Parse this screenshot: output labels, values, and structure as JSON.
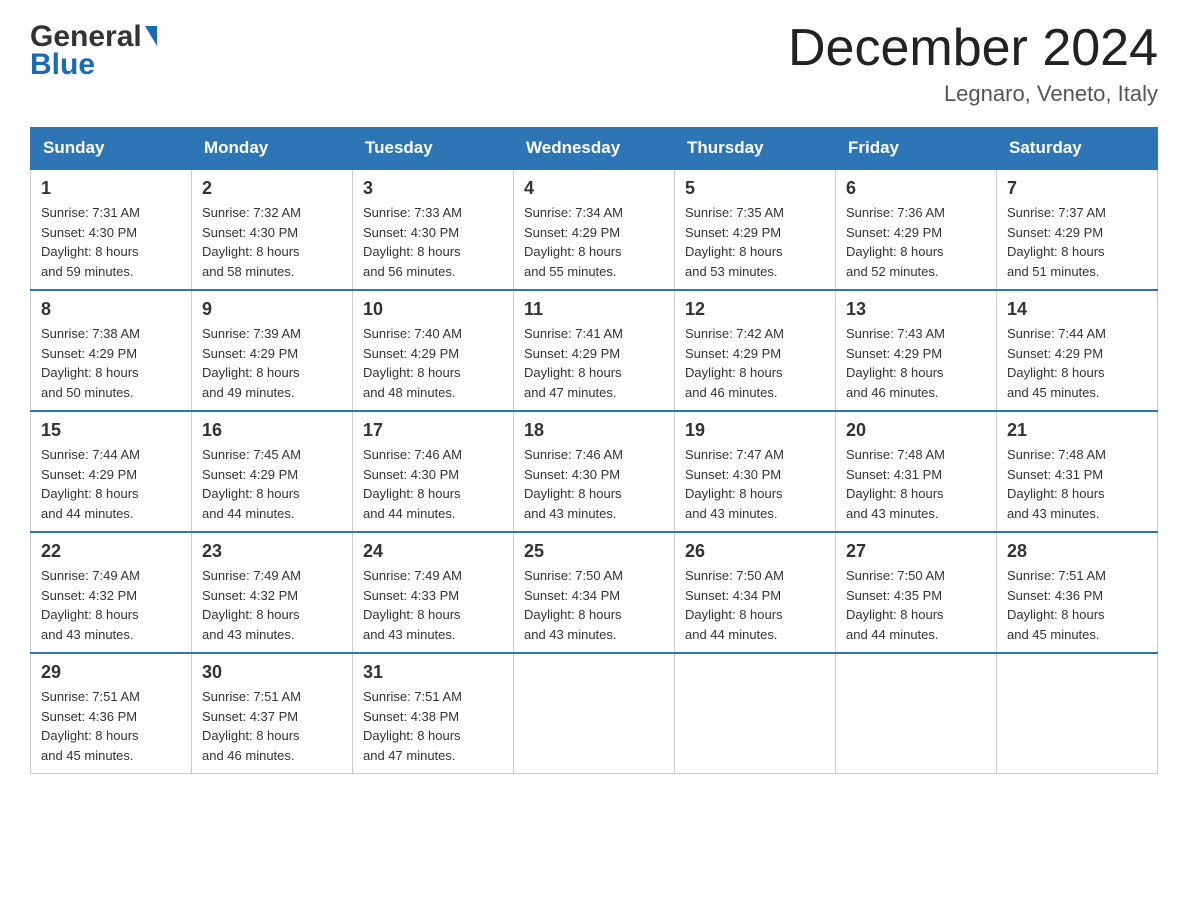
{
  "header": {
    "logo_general": "General",
    "logo_blue": "Blue",
    "month_title": "December 2024",
    "location": "Legnaro, Veneto, Italy"
  },
  "days_of_week": [
    "Sunday",
    "Monday",
    "Tuesday",
    "Wednesday",
    "Thursday",
    "Friday",
    "Saturday"
  ],
  "weeks": [
    [
      {
        "num": "1",
        "info": "Sunrise: 7:31 AM\nSunset: 4:30 PM\nDaylight: 8 hours\nand 59 minutes."
      },
      {
        "num": "2",
        "info": "Sunrise: 7:32 AM\nSunset: 4:30 PM\nDaylight: 8 hours\nand 58 minutes."
      },
      {
        "num": "3",
        "info": "Sunrise: 7:33 AM\nSunset: 4:30 PM\nDaylight: 8 hours\nand 56 minutes."
      },
      {
        "num": "4",
        "info": "Sunrise: 7:34 AM\nSunset: 4:29 PM\nDaylight: 8 hours\nand 55 minutes."
      },
      {
        "num": "5",
        "info": "Sunrise: 7:35 AM\nSunset: 4:29 PM\nDaylight: 8 hours\nand 53 minutes."
      },
      {
        "num": "6",
        "info": "Sunrise: 7:36 AM\nSunset: 4:29 PM\nDaylight: 8 hours\nand 52 minutes."
      },
      {
        "num": "7",
        "info": "Sunrise: 7:37 AM\nSunset: 4:29 PM\nDaylight: 8 hours\nand 51 minutes."
      }
    ],
    [
      {
        "num": "8",
        "info": "Sunrise: 7:38 AM\nSunset: 4:29 PM\nDaylight: 8 hours\nand 50 minutes."
      },
      {
        "num": "9",
        "info": "Sunrise: 7:39 AM\nSunset: 4:29 PM\nDaylight: 8 hours\nand 49 minutes."
      },
      {
        "num": "10",
        "info": "Sunrise: 7:40 AM\nSunset: 4:29 PM\nDaylight: 8 hours\nand 48 minutes."
      },
      {
        "num": "11",
        "info": "Sunrise: 7:41 AM\nSunset: 4:29 PM\nDaylight: 8 hours\nand 47 minutes."
      },
      {
        "num": "12",
        "info": "Sunrise: 7:42 AM\nSunset: 4:29 PM\nDaylight: 8 hours\nand 46 minutes."
      },
      {
        "num": "13",
        "info": "Sunrise: 7:43 AM\nSunset: 4:29 PM\nDaylight: 8 hours\nand 46 minutes."
      },
      {
        "num": "14",
        "info": "Sunrise: 7:44 AM\nSunset: 4:29 PM\nDaylight: 8 hours\nand 45 minutes."
      }
    ],
    [
      {
        "num": "15",
        "info": "Sunrise: 7:44 AM\nSunset: 4:29 PM\nDaylight: 8 hours\nand 44 minutes."
      },
      {
        "num": "16",
        "info": "Sunrise: 7:45 AM\nSunset: 4:29 PM\nDaylight: 8 hours\nand 44 minutes."
      },
      {
        "num": "17",
        "info": "Sunrise: 7:46 AM\nSunset: 4:30 PM\nDaylight: 8 hours\nand 44 minutes."
      },
      {
        "num": "18",
        "info": "Sunrise: 7:46 AM\nSunset: 4:30 PM\nDaylight: 8 hours\nand 43 minutes."
      },
      {
        "num": "19",
        "info": "Sunrise: 7:47 AM\nSunset: 4:30 PM\nDaylight: 8 hours\nand 43 minutes."
      },
      {
        "num": "20",
        "info": "Sunrise: 7:48 AM\nSunset: 4:31 PM\nDaylight: 8 hours\nand 43 minutes."
      },
      {
        "num": "21",
        "info": "Sunrise: 7:48 AM\nSunset: 4:31 PM\nDaylight: 8 hours\nand 43 minutes."
      }
    ],
    [
      {
        "num": "22",
        "info": "Sunrise: 7:49 AM\nSunset: 4:32 PM\nDaylight: 8 hours\nand 43 minutes."
      },
      {
        "num": "23",
        "info": "Sunrise: 7:49 AM\nSunset: 4:32 PM\nDaylight: 8 hours\nand 43 minutes."
      },
      {
        "num": "24",
        "info": "Sunrise: 7:49 AM\nSunset: 4:33 PM\nDaylight: 8 hours\nand 43 minutes."
      },
      {
        "num": "25",
        "info": "Sunrise: 7:50 AM\nSunset: 4:34 PM\nDaylight: 8 hours\nand 43 minutes."
      },
      {
        "num": "26",
        "info": "Sunrise: 7:50 AM\nSunset: 4:34 PM\nDaylight: 8 hours\nand 44 minutes."
      },
      {
        "num": "27",
        "info": "Sunrise: 7:50 AM\nSunset: 4:35 PM\nDaylight: 8 hours\nand 44 minutes."
      },
      {
        "num": "28",
        "info": "Sunrise: 7:51 AM\nSunset: 4:36 PM\nDaylight: 8 hours\nand 45 minutes."
      }
    ],
    [
      {
        "num": "29",
        "info": "Sunrise: 7:51 AM\nSunset: 4:36 PM\nDaylight: 8 hours\nand 45 minutes."
      },
      {
        "num": "30",
        "info": "Sunrise: 7:51 AM\nSunset: 4:37 PM\nDaylight: 8 hours\nand 46 minutes."
      },
      {
        "num": "31",
        "info": "Sunrise: 7:51 AM\nSunset: 4:38 PM\nDaylight: 8 hours\nand 47 minutes."
      },
      null,
      null,
      null,
      null
    ]
  ],
  "accent_color": "#2e75b6"
}
